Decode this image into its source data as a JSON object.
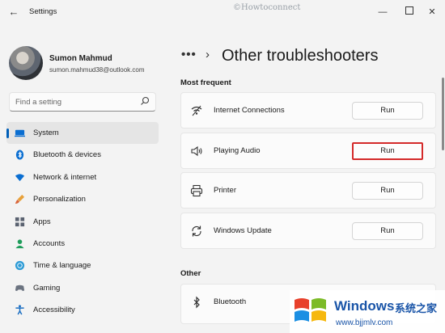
{
  "window": {
    "title": "Settings",
    "watermark": "©Howtoconnect"
  },
  "profile": {
    "name": "Sumon Mahmud",
    "email": "sumon.mahmud38@outlook.com"
  },
  "search": {
    "placeholder": "Find a setting"
  },
  "sidebar": {
    "items": [
      {
        "label": "System",
        "icon": "laptop-icon",
        "active": true
      },
      {
        "label": "Bluetooth & devices",
        "icon": "bluetooth-icon"
      },
      {
        "label": "Network & internet",
        "icon": "wifi-icon"
      },
      {
        "label": "Personalization",
        "icon": "brush-icon"
      },
      {
        "label": "Apps",
        "icon": "apps-icon"
      },
      {
        "label": "Accounts",
        "icon": "person-icon"
      },
      {
        "label": "Time & language",
        "icon": "globe-icon"
      },
      {
        "label": "Gaming",
        "icon": "gamepad-icon"
      },
      {
        "label": "Accessibility",
        "icon": "accessibility-icon"
      }
    ]
  },
  "main": {
    "breadcrumb_more": "•••",
    "breadcrumb_sep": "›",
    "title": "Other troubleshooters",
    "sections": {
      "most_frequent": "Most frequent",
      "other": "Other"
    },
    "items": [
      {
        "label": "Internet Connections",
        "icon": "wifi-icon",
        "button": "Run"
      },
      {
        "label": "Playing Audio",
        "icon": "speaker-icon",
        "button": "Run",
        "highlighted": true
      },
      {
        "label": "Printer",
        "icon": "printer-icon",
        "button": "Run"
      },
      {
        "label": "Windows Update",
        "icon": "sync-icon",
        "button": "Run"
      },
      {
        "label": "Bluetooth",
        "icon": "bluetooth-icon"
      }
    ]
  },
  "overlay_watermark": {
    "title": "Windows",
    "subtitle": "系统之家",
    "url": "www.bjjmlv.com"
  },
  "colors": {
    "accent": "#005fb8",
    "highlight": "#d42a2a",
    "watermark_blue": "#1a55a8"
  }
}
